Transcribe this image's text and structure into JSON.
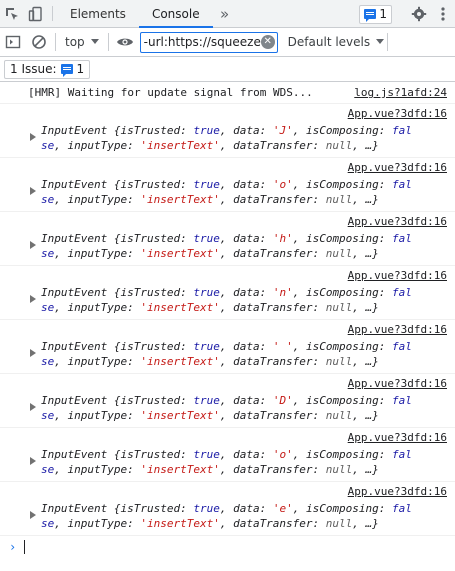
{
  "tabbar": {
    "tabs": [
      {
        "label": "Elements"
      },
      {
        "label": "Console"
      }
    ],
    "more_tabs_glyph": "»",
    "issues_count": "1",
    "icons": [
      "inspect-icon",
      "device-toggle-icon",
      "gear-icon",
      "kebab-menu-icon"
    ]
  },
  "toolbar": {
    "context": "top",
    "filter_value": "-url:https://squeezer",
    "levels": "Default levels"
  },
  "issues_bar": {
    "label": "1 Issue:",
    "count": "1"
  },
  "console": {
    "first": {
      "text": "[HMR] Waiting for update signal from WDS...",
      "source": "log.js?1afd:24"
    },
    "source": "App.vue?3dfd:16",
    "entries": [
      {
        "data": "'J'"
      },
      {
        "data": "'o'"
      },
      {
        "data": "'h'"
      },
      {
        "data": "'n'"
      },
      {
        "data": "' '"
      },
      {
        "data": "'D'"
      },
      {
        "data": "'o'"
      },
      {
        "data": "'e'"
      }
    ],
    "obj_name": "InputEvent",
    "t1": "{isTrusted: ",
    "v_true": "true",
    "t2": ", data: ",
    "t3": ", isComposing: ",
    "v_fal": "fal",
    "v_se": "se",
    "t4": ", inputType: ",
    "v_input": "'insertText'",
    "t5": ", dataTransfer: ",
    "v_null": "null",
    "t6": ", …}",
    "prompt": "›"
  },
  "colors": {
    "accent": "#1a73e8",
    "keyword": "#881391",
    "string": "#c41a16",
    "literal": "#1a1aa6"
  }
}
